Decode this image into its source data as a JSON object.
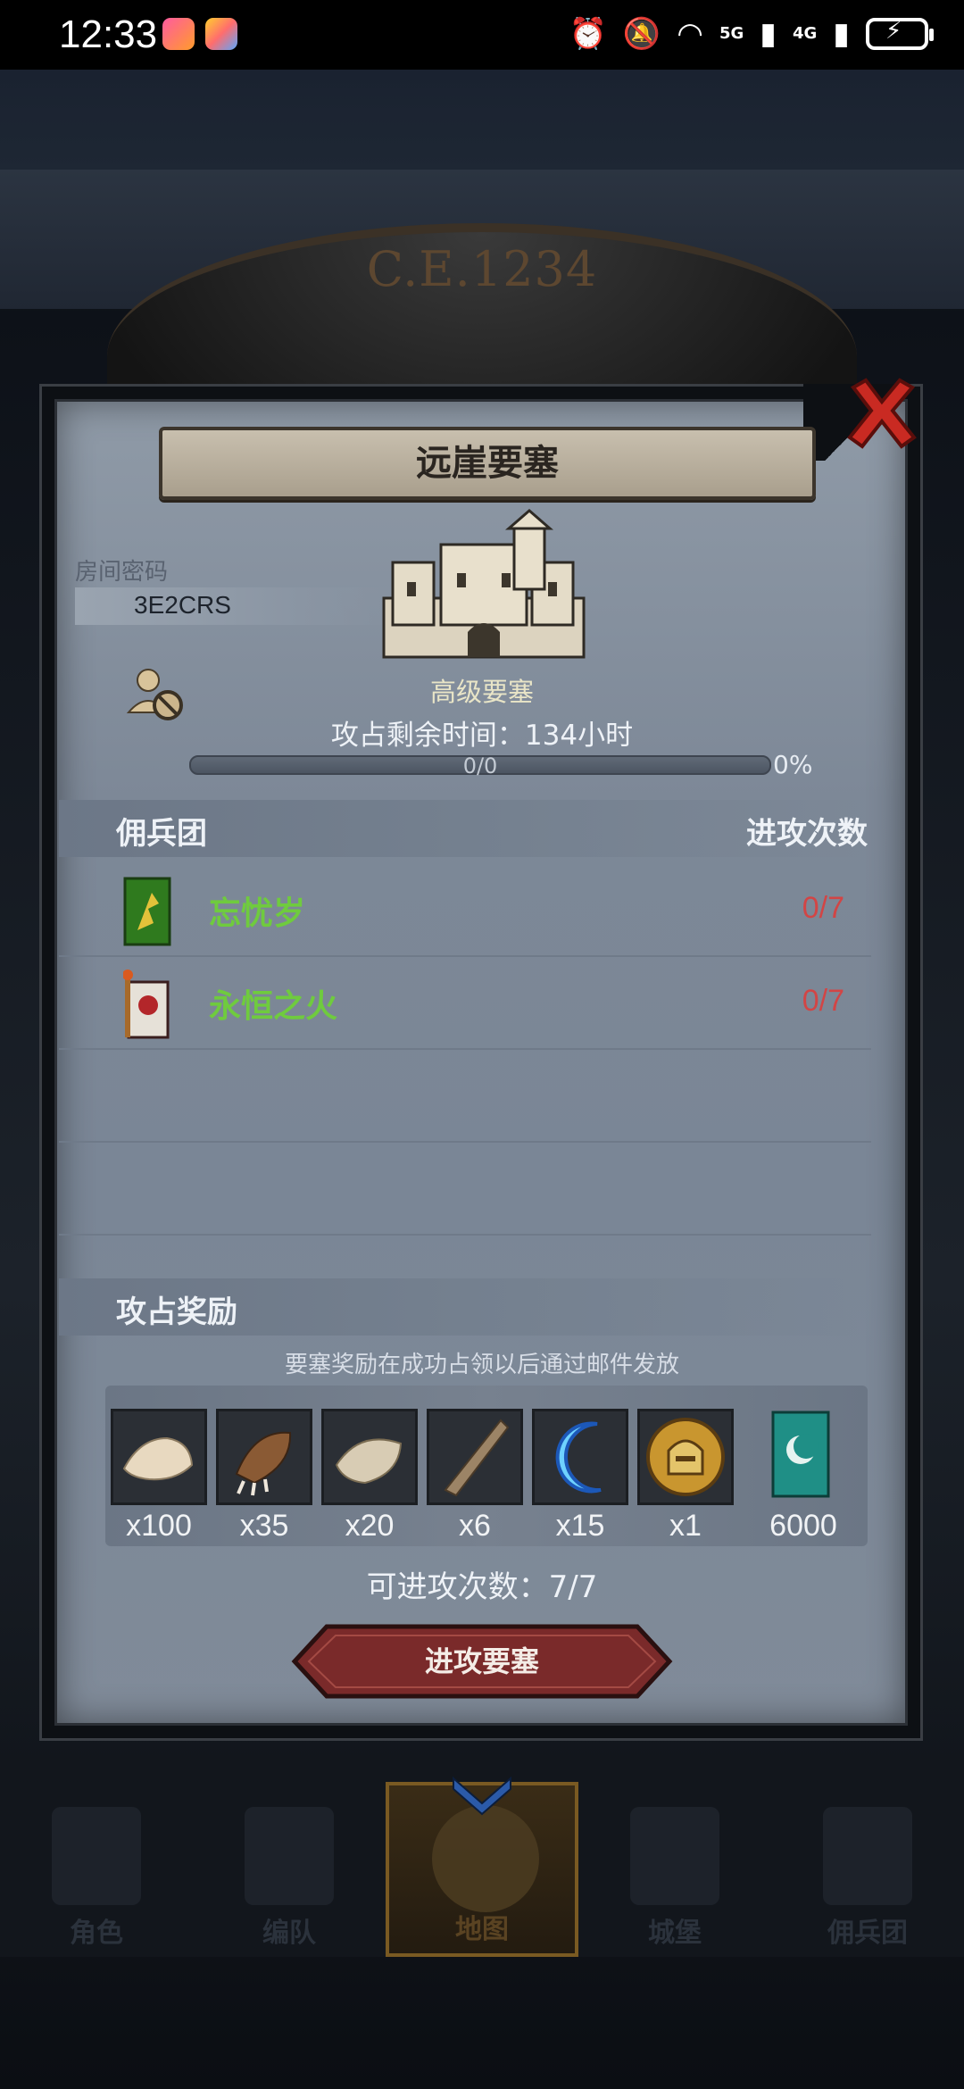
{
  "status_bar": {
    "time": "12:33",
    "net1": "5G",
    "net2": "4G"
  },
  "game": {
    "year": "C.E.1234"
  },
  "dialog": {
    "title": "远崖要塞",
    "room_password_label": "房间密码",
    "room_code": "3E2CRS",
    "fort_grade": "高级要塞",
    "time_left": "攻占剩余时间：134小时",
    "progress": {
      "label": "0/0",
      "percent_text": "0%",
      "value": 0
    },
    "mercenary_header": "佣兵团",
    "attack_count_header": "进攻次数",
    "guilds": [
      {
        "name": "忘忧岁",
        "attacks": "0/7",
        "banner": "green-dragon-banner-icon"
      },
      {
        "name": "永恒之火",
        "attacks": "0/7",
        "banner": "red-flame-banner-icon"
      }
    ],
    "reward_header": "攻占奖励",
    "reward_note": "要塞奖励在成功占领以后通过邮件发放",
    "rewards": [
      {
        "qty": "x100",
        "icon": "fur-pelt-icon"
      },
      {
        "qty": "x35",
        "icon": "claw-icon"
      },
      {
        "qty": "x20",
        "icon": "scale-hide-icon"
      },
      {
        "qty": "x6",
        "icon": "horn-icon"
      },
      {
        "qty": "x15",
        "icon": "blue-crescent-icon"
      },
      {
        "qty": "x1",
        "icon": "golden-helmet-medal-icon"
      },
      {
        "qty": "6000",
        "icon": "teal-banner-icon"
      }
    ],
    "attack_times": "可进攻次数：7/7",
    "attack_button": "进攻要塞"
  },
  "nav": {
    "items": [
      {
        "label": "角色"
      },
      {
        "label": "编队"
      },
      {
        "label": "地图"
      },
      {
        "label": "城堡"
      },
      {
        "label": "佣兵团"
      }
    ],
    "active_index": 2
  },
  "colors": {
    "guild_name": "#6fcb3e",
    "attack_count": "#d24545",
    "attack_button": "#7a2a2a"
  }
}
